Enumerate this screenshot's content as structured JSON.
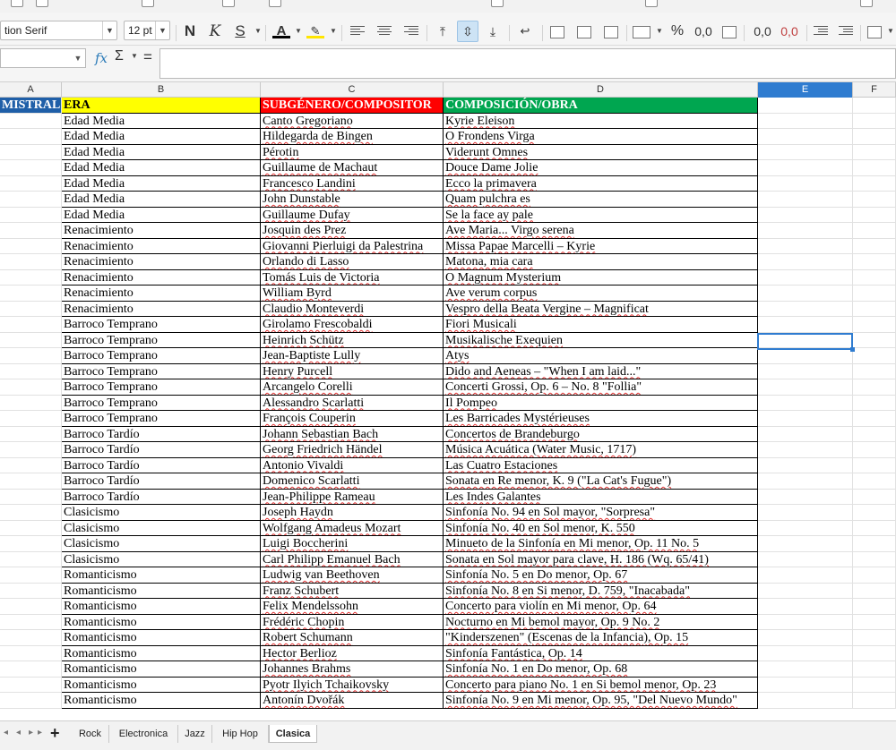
{
  "toolbar": {
    "font_name": "tion Serif",
    "font_size": "12 pt",
    "bold_label": "N",
    "italic_label": "K",
    "underline_label": "S",
    "percent_label": "%",
    "decimal_label": "0,0",
    "add_decimal_label": "0,0",
    "remove_decimal_label": "0,0"
  },
  "formula_bar": {
    "name_box": "",
    "fx_label": "fx",
    "sigma_label": "Σ",
    "equals_label": "=",
    "content": ""
  },
  "columns": [
    "A",
    "B",
    "C",
    "D",
    "E",
    "F"
  ],
  "active_column": "E",
  "headers": {
    "a": "MISTRAL",
    "b": "ERA",
    "c": "SUBGÉNERO/COMPOSITOR",
    "d": "COMPOSICIÓN/OBRA"
  },
  "header_colors": {
    "a": "#1f5fa8",
    "b": "#ffff00",
    "c": "#ff0000",
    "d": "#00a650"
  },
  "rows": [
    {
      "era": "Edad Media",
      "composer": "Canto Gregoriano",
      "work": "Kyrie Eleison"
    },
    {
      "era": "Edad Media",
      "composer": "Hildegarda de Bingen",
      "work": "O Frondens Virga"
    },
    {
      "era": "Edad Media",
      "composer": "Pérotin",
      "work": "Viderunt Omnes"
    },
    {
      "era": "Edad Media",
      "composer": "Guillaume de Machaut",
      "work": "Douce Dame Jolie"
    },
    {
      "era": "Edad Media",
      "composer": "Francesco Landini",
      "work": "Ecco la primavera"
    },
    {
      "era": "Edad Media",
      "composer": "John Dunstable",
      "work": "Quam pulchra es"
    },
    {
      "era": "Edad Media",
      "composer": "Guillaume Dufay",
      "work": "Se la face ay pale"
    },
    {
      "era": "Renacimiento",
      "composer": "Josquin des Prez",
      "work": "Ave Maria... Virgo serena"
    },
    {
      "era": "Renacimiento",
      "composer": "Giovanni Pierluigi da Palestrina",
      "work": "Missa Papae Marcelli – Kyrie"
    },
    {
      "era": "Renacimiento",
      "composer": "Orlando di Lasso",
      "work": "Matona, mia cara"
    },
    {
      "era": "Renacimiento",
      "composer": "Tomás Luis de Victoria",
      "work": "O Magnum Mysterium"
    },
    {
      "era": "Renacimiento",
      "composer": "William Byrd",
      "work": "Ave verum corpus"
    },
    {
      "era": "Renacimiento",
      "composer": "Claudio Monteverdi",
      "work": "Vespro della Beata Vergine – Magnificat"
    },
    {
      "era": "Barroco Temprano",
      "composer": "Girolamo Frescobaldi",
      "work": "Fiori Musicali"
    },
    {
      "era": "Barroco Temprano",
      "composer": "Heinrich Schütz",
      "work": "Musikalische Exequien"
    },
    {
      "era": "Barroco Temprano",
      "composer": "Jean-Baptiste Lully",
      "work": "Atys"
    },
    {
      "era": "Barroco Temprano",
      "composer": "Henry Purcell",
      "work": "Dido and Aeneas – \"When I am laid...\""
    },
    {
      "era": "Barroco Temprano",
      "composer": "Arcangelo Corelli",
      "work": "Concerti Grossi, Op. 6 – No. 8 \"Follia\""
    },
    {
      "era": "Barroco Temprano",
      "composer": "Alessandro Scarlatti",
      "work": "Il Pompeo"
    },
    {
      "era": "Barroco Temprano",
      "composer": "François Couperin",
      "work": "Les Barricades Mystérieuses"
    },
    {
      "era": "Barroco Tardío",
      "composer": "Johann Sebastian Bach",
      "work": "Concertos de Brandeburgo"
    },
    {
      "era": "Barroco Tardío",
      "composer": "Georg Friedrich Händel",
      "work": "Música Acuática (Water Music, 1717)"
    },
    {
      "era": "Barroco Tardío",
      "composer": "Antonio Vivaldi",
      "work": "Las Cuatro Estaciones"
    },
    {
      "era": "Barroco Tardío",
      "composer": "Domenico Scarlatti",
      "work": "Sonata en Re menor, K. 9 (\"La Cat's Fugue\")"
    },
    {
      "era": "Barroco Tardío",
      "composer": "Jean-Philippe Rameau",
      "work": "Les Indes Galantes"
    },
    {
      "era": "Clasicismo",
      "composer": "Joseph Haydn",
      "work": "Sinfonía No. 94 en Sol mayor, \"Sorpresa\""
    },
    {
      "era": "Clasicismo",
      "composer": "Wolfgang Amadeus Mozart",
      "work": "Sinfonía No. 40 en Sol menor, K. 550"
    },
    {
      "era": "Clasicismo",
      "composer": "Luigi Boccherini",
      "work": "Minueto de la Sinfonía en Mi menor, Op. 11 No. 5"
    },
    {
      "era": "Clasicismo",
      "composer": "Carl Philipp Emanuel Bach",
      "work": "Sonata en Sol mayor para clave, H. 186 (Wq. 65/41)"
    },
    {
      "era": "Romanticismo",
      "composer": "Ludwig van Beethoven",
      "work": "Sinfonía No. 5 en Do menor, Op. 67"
    },
    {
      "era": "Romanticismo",
      "composer": "Franz Schubert",
      "work": "Sinfonía No. 8 en Si menor, D. 759, \"Inacabada\""
    },
    {
      "era": "Romanticismo",
      "composer": "Felix Mendelssohn",
      "work": "Concerto para violín en Mi menor, Op. 64"
    },
    {
      "era": "Romanticismo",
      "composer": "Frédéric Chopin",
      "work": "Nocturno en Mi bemol mayor, Op. 9 No. 2"
    },
    {
      "era": "Romanticismo",
      "composer": "Robert Schumann",
      "work": "\"Kinderszenen\" (Escenas de la Infancia), Op. 15"
    },
    {
      "era": "Romanticismo",
      "composer": "Hector Berlioz",
      "work": "Sinfonía Fantástica, Op. 14"
    },
    {
      "era": "Romanticismo",
      "composer": "Johannes Brahms",
      "work": "Sinfonía No. 1 en Do menor, Op. 68"
    },
    {
      "era": "Romanticismo",
      "composer": "Pyotr Ilyich Tchaikovsky",
      "work": "Concerto para piano No. 1 en Si bemol menor, Op. 23"
    },
    {
      "era": "Romanticismo",
      "composer": "Antonín Dvořák",
      "work": "Sinfonía No. 9 en Mi menor, Op. 95, \"Del Nuevo Mundo\""
    }
  ],
  "sheet_tabs": [
    {
      "label": "Rock",
      "active": false
    },
    {
      "label": "Electronica",
      "active": false
    },
    {
      "label": "Jazz",
      "active": false
    },
    {
      "label": "Hip Hop",
      "active": false
    },
    {
      "label": "Clasica",
      "active": true
    }
  ],
  "add_sheet_label": "+"
}
